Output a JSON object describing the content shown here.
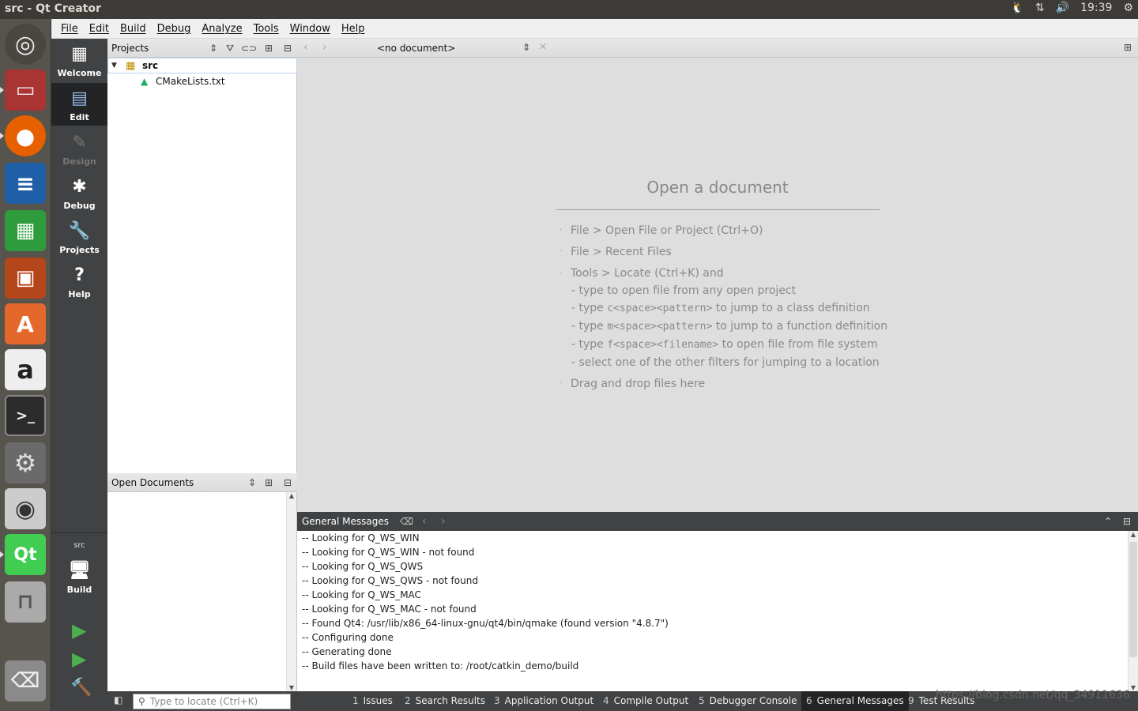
{
  "topbar": {
    "window_title": "src - Qt Creator",
    "clock": "19:39",
    "indicator_icons": [
      "tux-icon",
      "network-icon",
      "volume-icon",
      "settings-gear-icon"
    ]
  },
  "launcher": {
    "items": [
      {
        "name": "ubuntu-dash-icon",
        "glyph": "◎"
      },
      {
        "name": "files-icon",
        "glyph": "▭"
      },
      {
        "name": "firefox-icon",
        "glyph": "●"
      },
      {
        "name": "writer-icon",
        "glyph": "≡"
      },
      {
        "name": "calc-icon",
        "glyph": "▦"
      },
      {
        "name": "impress-icon",
        "glyph": "▣"
      },
      {
        "name": "software-center-icon",
        "glyph": "A"
      },
      {
        "name": "amazon-icon",
        "glyph": "a"
      },
      {
        "name": "terminal-icon",
        "glyph": ">_"
      },
      {
        "name": "system-settings-icon",
        "glyph": "⚙"
      },
      {
        "name": "camera-icon",
        "glyph": "◉"
      },
      {
        "name": "qt-creator-icon",
        "glyph": "Qt"
      },
      {
        "name": "usb-drive-icon",
        "glyph": "⊓"
      },
      {
        "name": "trash-icon",
        "glyph": "⌫"
      }
    ]
  },
  "menubar": {
    "items": [
      "File",
      "Edit",
      "Build",
      "Debug",
      "Analyze",
      "Tools",
      "Window",
      "Help"
    ]
  },
  "modes": {
    "items": [
      {
        "label": "Welcome",
        "icon": "grid-icon"
      },
      {
        "label": "Edit",
        "icon": "edit-document-icon"
      },
      {
        "label": "Design",
        "icon": "pencil-icon"
      },
      {
        "label": "Debug",
        "icon": "bug-icon"
      },
      {
        "label": "Projects",
        "icon": "wrench-icon"
      },
      {
        "label": "Help",
        "icon": "help-icon"
      }
    ],
    "kit_project": "src",
    "kit_label": "Build"
  },
  "projects_pane": {
    "title": "Projects",
    "tree": {
      "root": "src",
      "children": [
        "CMakeLists.txt"
      ]
    }
  },
  "open_documents_pane": {
    "title": "Open Documents"
  },
  "editor": {
    "document_selector": "<no document>",
    "open_title": "Open a document",
    "tips": {
      "open_file": "File > Open File or Project (Ctrl+O)",
      "recent": "File > Recent Files",
      "locate": "Tools > Locate (Ctrl+K) and",
      "locate_sub1": "- type to open file from any open project",
      "locate_sub2_a": "- type ",
      "locate_sub2_code": "c<space><pattern>",
      "locate_sub2_b": " to jump to a class definition",
      "locate_sub3_a": "- type ",
      "locate_sub3_code": "m<space><pattern>",
      "locate_sub3_b": " to jump to a function definition",
      "locate_sub4_a": "- type ",
      "locate_sub4_code": "f<space><filename>",
      "locate_sub4_b": " to open file from file system",
      "locate_sub5": "- select one of the other filters for jumping to a location",
      "drag": "Drag and drop files here"
    }
  },
  "output_pane": {
    "title": "General Messages",
    "lines": [
      "-- Looking for Q_WS_WIN",
      "-- Looking for Q_WS_WIN - not found",
      "-- Looking for Q_WS_QWS",
      "-- Looking for Q_WS_QWS - not found",
      "-- Looking for Q_WS_MAC",
      "-- Looking for Q_WS_MAC - not found",
      "-- Found Qt4: /usr/lib/x86_64-linux-gnu/qt4/bin/qmake (found version \"4.8.7\")",
      "-- Configuring done",
      "-- Generating done",
      "-- Build files have been written to: /root/catkin_demo/build"
    ]
  },
  "statusbar": {
    "locator_placeholder": "Type to locate (Ctrl+K)",
    "tabs": [
      {
        "num": "1",
        "label": "Issues"
      },
      {
        "num": "2",
        "label": "Search Results"
      },
      {
        "num": "3",
        "label": "Application Output"
      },
      {
        "num": "4",
        "label": "Compile Output"
      },
      {
        "num": "5",
        "label": "Debugger Console"
      },
      {
        "num": "6",
        "label": "General Messages"
      },
      {
        "num": "9",
        "label": "Test Results"
      }
    ],
    "active_tab": "General Messages"
  },
  "watermark": "https://blog.csdn.net/qq_34911636",
  "colors": {
    "panel": "#3c3b37",
    "launcher": "#57534d",
    "modebar": "#404244",
    "mode_active": "#232425",
    "editor_bg": "#dedede",
    "run_green": "#4caf50"
  }
}
